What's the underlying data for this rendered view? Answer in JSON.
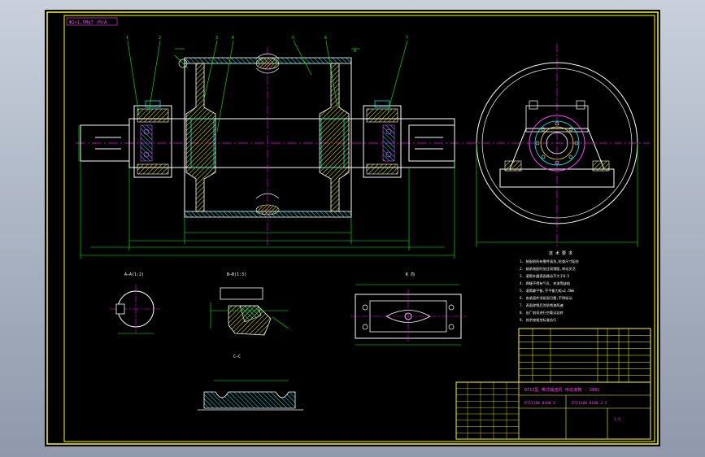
{
  "drawing": {
    "corner_label": "Φ1×1.5Mg7 /M/A",
    "callouts": [
      "1",
      "2",
      "3",
      "4",
      "5",
      "6",
      "7",
      "8"
    ],
    "section_a": "A—A(1:2)",
    "section_b": "B—B(1:3)",
    "detail_c": "C—C",
    "view_k": "K 向",
    "tech_req_title": "技 术 要 求",
    "tech_req_lines": [
      "1. 装配前所有零件清洗,检查尺寸配合",
      "2. 轴承装配时加注润滑脂,转动灵活",
      "3. 滚筒外圆表面跳动不大于0.5",
      "4. 焊缝不得有气孔、夹渣等缺陷",
      "5. 滚筒静平衡,不平衡力矩≤1.5Nm",
      "6. 各紧固件须紧固可靠,不得松动",
      "7. 表面除锈后涂防锈漆两遍",
      "8. 出厂前须进行空载试运转",
      "9. 其余按相关标准执行"
    ],
    "title_block": {
      "title": "DTII型 带式输送机 传动滚筒 - 2002",
      "code": "DTII100 8100-Z",
      "drawing_no": "DTII100 8100-Z-5",
      "scale": "1:5"
    }
  },
  "colors": {
    "bg": "#000000",
    "frame": "#ffff00",
    "outline": "#ffffff",
    "center": "#ff00ff",
    "dimension": "#00ff00",
    "hidden": "#00ffff",
    "hatch": "#ffff00",
    "pink": "#ff44ff"
  }
}
